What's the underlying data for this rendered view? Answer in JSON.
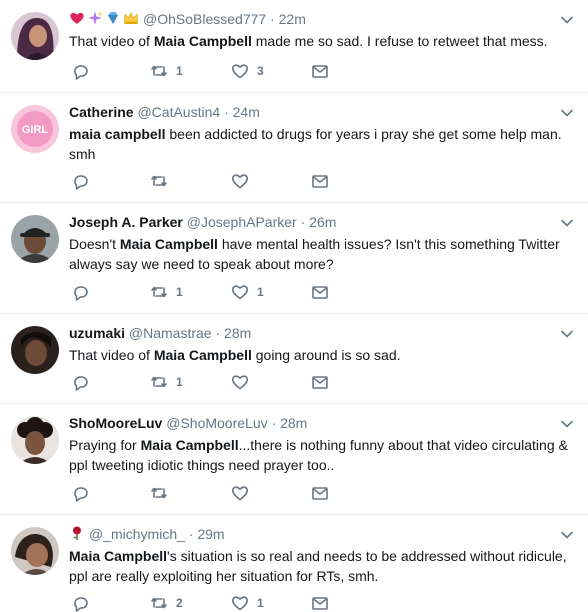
{
  "tweets": [
    {
      "name": "",
      "emojis": [
        "red-heart",
        "sparkles",
        "blue-diamond",
        "crown"
      ],
      "handle": "@OhSoBlessed777",
      "time": "22m",
      "text_parts": [
        {
          "t": "That video of ",
          "b": false
        },
        {
          "t": "Maia Campbell",
          "b": true
        },
        {
          "t": " made me so sad. I refuse to retweet that mess.",
          "b": false
        }
      ],
      "retweets": "1",
      "likes": "3",
      "avatar": "woman-purple-hair-avatar"
    },
    {
      "name": "Catherine",
      "emojis": [],
      "handle": "@CatAustin4",
      "time": "24m",
      "text_parts": [
        {
          "t": "maia campbell",
          "b": true
        },
        {
          "t": " been addicted to drugs for years i pray she get some help man. smh",
          "b": false
        }
      ],
      "retweets": "",
      "likes": "",
      "avatar": "pink-logo-avatar",
      "avatar_text": "GIRL"
    },
    {
      "name": "Joseph A. Parker",
      "emojis": [],
      "handle": "@JosephAParker",
      "time": "26m",
      "text_parts": [
        {
          "t": "Doesn't ",
          "b": false
        },
        {
          "t": "Maia Campbell",
          "b": true
        },
        {
          "t": " have mental health issues? Isn't this something Twitter always say we need to speak about more?",
          "b": false
        }
      ],
      "retweets": "1",
      "likes": "1",
      "avatar": "man-cap-avatar"
    },
    {
      "name": "uzumaki",
      "emojis": [],
      "handle": "@Namastrae",
      "time": "28m",
      "text_parts": [
        {
          "t": "That video of ",
          "b": false
        },
        {
          "t": "Maia Campbell",
          "b": true
        },
        {
          "t": " going around is so sad.",
          "b": false
        }
      ],
      "retweets": "1",
      "likes": "",
      "avatar": "dark-portrait-avatar"
    },
    {
      "name": "ShoMooreLuv",
      "emojis": [],
      "handle": "@ShoMooreLuv",
      "time": "28m",
      "text_parts": [
        {
          "t": "Praying for ",
          "b": false
        },
        {
          "t": "Maia Campbell",
          "b": true
        },
        {
          "t": "...there is nothing funny about that video circulating & ppl tweeting idiotic things need prayer too..",
          "b": false
        }
      ],
      "retweets": "",
      "likes": "",
      "avatar": "woman-curly-hair-avatar"
    },
    {
      "name": "",
      "emojis": [
        "rose"
      ],
      "handle": "@_michymich_",
      "time": "29m",
      "text_parts": [
        {
          "t": "Maia Campbell",
          "b": true
        },
        {
          "t": "'s situation is so real and needs to be addressed without ridicule, ppl are really exploiting her situation for RTs, smh.",
          "b": false
        }
      ],
      "retweets": "2",
      "likes": "1",
      "avatar": "woman-selfie-avatar"
    }
  ],
  "colors": {
    "text": "#14171a",
    "muted": "#657786",
    "border": "#e6ecf0",
    "icon": "#657786"
  },
  "icons": {
    "reply": "reply-icon",
    "retweet": "retweet-icon",
    "like": "heart-icon",
    "dm": "envelope-icon",
    "caret": "chevron-down-icon"
  }
}
